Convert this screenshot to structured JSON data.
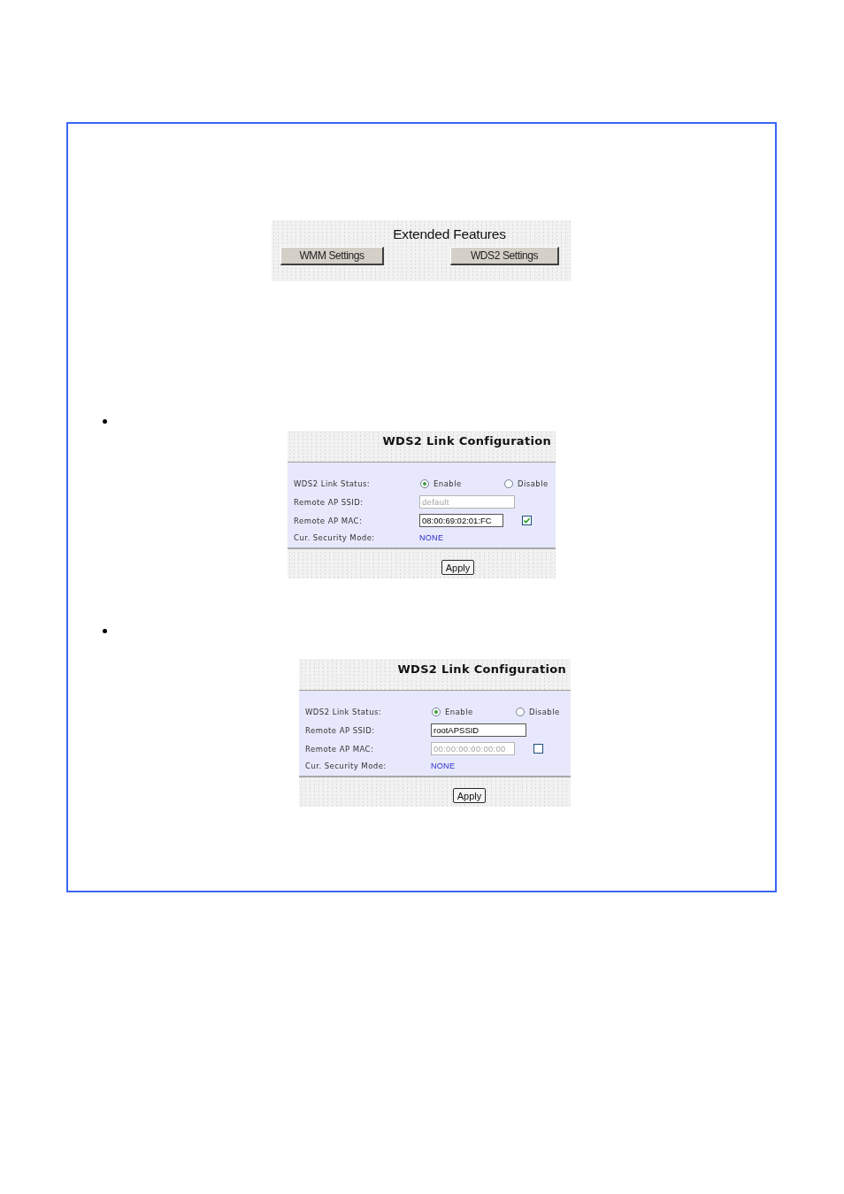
{
  "extended_features": {
    "title": "Extended Features",
    "buttons": [
      "WMM Settings",
      "WDS2 Settings"
    ]
  },
  "config_panels": [
    {
      "title": "WDS2 Link Configuration",
      "rows": [
        {
          "kind": "radio",
          "label": "WDS2 Link Status:",
          "options": [
            {
              "label": "Enable",
              "selected": true
            },
            {
              "label": "Disable",
              "selected": false
            }
          ]
        },
        {
          "kind": "input",
          "label": "Remote AP SSID:",
          "value": "default",
          "disabled": true
        },
        {
          "kind": "input",
          "label": "Remote AP MAC:",
          "value": "08:00:69:02:01:FC",
          "disabled": false,
          "checkbox": {
            "checked": true
          }
        },
        {
          "kind": "value",
          "label": "Cur. Security Mode:",
          "value": "NONE"
        }
      ],
      "button": "Apply"
    },
    {
      "title": "WDS2 Link Configuration",
      "rows": [
        {
          "kind": "radio",
          "label": "WDS2 Link Status:",
          "options": [
            {
              "label": "Enable",
              "selected": true
            },
            {
              "label": "Disable",
              "selected": false
            }
          ]
        },
        {
          "kind": "input",
          "label": "Remote AP SSID:",
          "value": "rootAPSSID",
          "disabled": false
        },
        {
          "kind": "input",
          "label": "Remote AP MAC:",
          "value": "00:00:00:00:00:00",
          "disabled": true,
          "checkbox": {
            "checked": false
          }
        },
        {
          "kind": "value",
          "label": "Cur. Security Mode:",
          "value": "NONE"
        }
      ],
      "button": "Apply"
    }
  ]
}
